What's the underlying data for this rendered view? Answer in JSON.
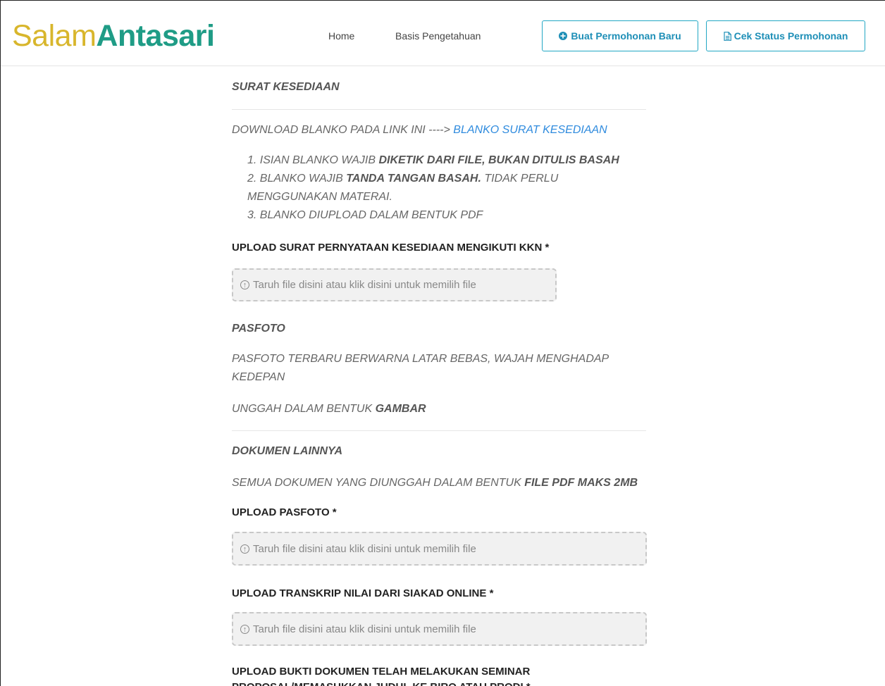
{
  "brand": {
    "part1": "Salam",
    "part2": "Antasari"
  },
  "nav": {
    "home": "Home",
    "basis": "Basis Pengetahuan",
    "buat_btn": "Buat Permohonan Baru",
    "cek_btn": "Cek Status Permohonan"
  },
  "surat": {
    "title": "SURAT KESEDIAAN",
    "download_text": "DOWNLOAD BLANKO PADA LINK INI ----> ",
    "download_link": "BLANKO SURAT KESEDIAAN",
    "items": [
      {
        "num": "1.",
        "pre": "ISIAN BLANKO WAJIB ",
        "bold": "DIKETIK DARI FILE, BUKAN DITULIS BASAH",
        "post": ""
      },
      {
        "num": "2.",
        "pre": "BLANKO WAJIB ",
        "bold": "TANDA TANGAN BASAH.",
        "post": " TIDAK PERLU MENGGUNAKAN MATERAI."
      },
      {
        "num": "3.",
        "pre": "BLANKO DIUPLOAD DALAM BENTUK PDF",
        "bold": "",
        "post": ""
      }
    ]
  },
  "upload_kesediaan": {
    "label": "UPLOAD SURAT PERNYATAAN KESEDIAAN MENGIKUTI KKN *",
    "placeholder": "Taruh file disini atau klik disini untuk memilih file"
  },
  "pasfoto": {
    "title": "PASFOTO",
    "desc": "PASFOTO TERBARU BERWARNA LATAR BEBAS, WAJAH MENGHADAP KEDEPAN",
    "format_pre": "UNGGAH DALAM BENTUK ",
    "format_bold": "GAMBAR"
  },
  "dokumen": {
    "title": "DOKUMEN LAINNYA",
    "desc_pre": "SEMUA DOKUMEN YANG DIUNGGAH DALAM BENTUK ",
    "desc_bold": "FILE PDF MAKS 2MB"
  },
  "upload_pasfoto": {
    "label": "UPLOAD PASFOTO *",
    "placeholder": "Taruh file disini atau klik disini untuk memilih file"
  },
  "upload_transkrip": {
    "label": "UPLOAD TRANSKRIP NILAI DARI SIAKAD ONLINE *",
    "placeholder": "Taruh file disini atau klik disini untuk memilih file"
  },
  "upload_seminar": {
    "label": "UPLOAD BUKTI DOKUMEN TELAH MELAKUKAN SEMINAR PROPOSAL/MEMASUKKAN JUDUL KE BIRO ATAU PRODI *"
  },
  "colors": {
    "brand_gold": "#d8b62c",
    "brand_green": "#1f9c86",
    "accent": "#22a7c4",
    "link": "#2f8bde"
  },
  "icons": {
    "buat": "plus-circle-icon",
    "cek": "document-icon",
    "upload": "upload-circle-icon"
  }
}
